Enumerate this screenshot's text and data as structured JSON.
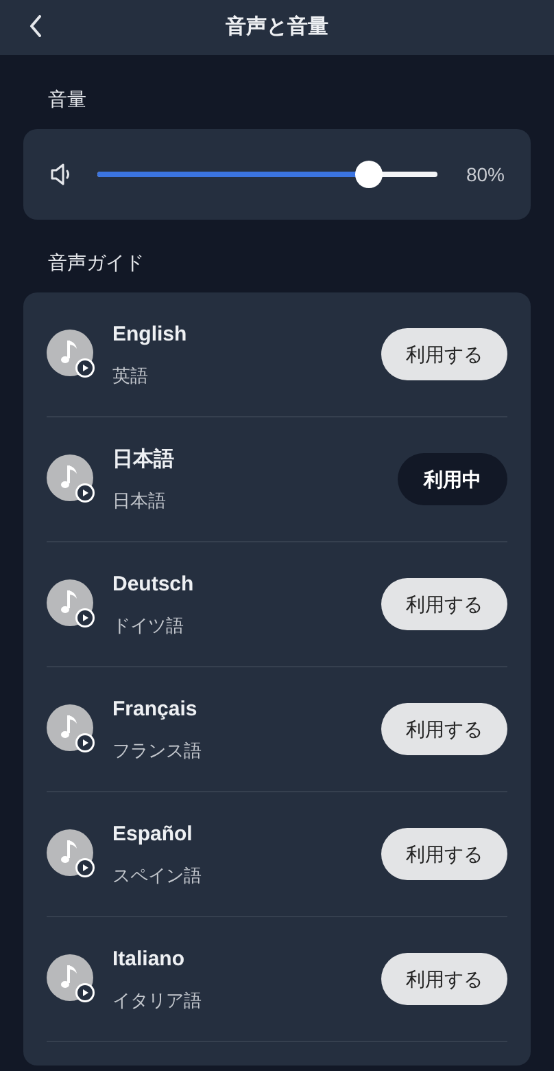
{
  "header": {
    "title": "音声と音量"
  },
  "volume": {
    "label": "音量",
    "level": 0.8,
    "reading": "80%"
  },
  "guide": {
    "label": "音声ガイド",
    "items": [
      {
        "name": "English",
        "subtitle": "英語",
        "action": "利用する",
        "selected": false
      },
      {
        "name": "日本語",
        "subtitle": "日本語",
        "action": "利用中",
        "selected": true
      },
      {
        "name": "Deutsch",
        "subtitle": "ドイツ語",
        "action": "利用する",
        "selected": false
      },
      {
        "name": "Français",
        "subtitle": "フランス語",
        "action": "利用する",
        "selected": false
      },
      {
        "name": "Español",
        "subtitle": "スペイン語",
        "action": "利用する",
        "selected": false
      },
      {
        "name": "Italiano",
        "subtitle": "イタリア語",
        "action": "利用する",
        "selected": false
      }
    ]
  }
}
